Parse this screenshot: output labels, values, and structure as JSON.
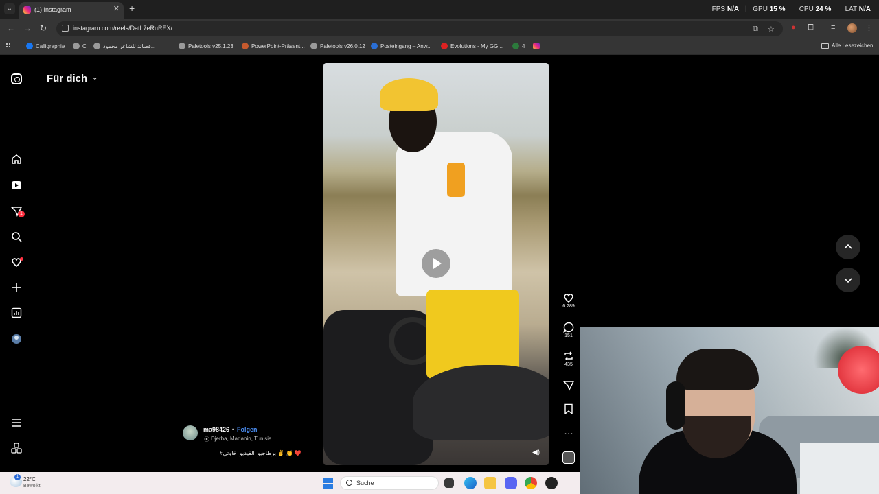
{
  "browser": {
    "tab_title": "(1) Instagram",
    "url": "instagram.com/reels/DatL7eRuREX/",
    "overlay": {
      "fps_label": "FPS",
      "fps_value": "N/A",
      "gpu_label": "GPU",
      "gpu_value": "15 %",
      "cpu_label": "CPU",
      "cpu_value": "24 %",
      "lat_label": "LAT",
      "lat_value": "N/A"
    },
    "bookmarks": [
      {
        "label": "Calligraphie",
        "color": "#1877f2"
      },
      {
        "label": "C",
        "color": "#9a9a9a"
      },
      {
        "label": "قصائد للشاعر محمود...",
        "color": "#9a9a9a"
      },
      {
        "label": "Paletools v25.1.23",
        "color": "#9a9a9a"
      },
      {
        "label": "PowerPoint-Präsent...",
        "color": "#c65a2e"
      },
      {
        "label": "Paletools v26.0.12",
        "color": "#9a9a9a"
      },
      {
        "label": "Posteingang – Anw...",
        "color": "#2a6fd6"
      },
      {
        "label": "Evolutions - My GG...",
        "color": "#d22"
      },
      {
        "label": "4",
        "color": "#2c7a3c"
      }
    ],
    "all_bookmarks_label": "Alle Lesezeichen"
  },
  "instagram": {
    "feed_title": "Für dich",
    "notification_count": "1",
    "reel": {
      "username": "ma98426",
      "separator": "•",
      "follow_label": "Folgen",
      "location": "Djerba, Madanin, Tunisia",
      "caption": "#برطاجيو_الفيديو_خاوتي ✌️ 👏 ❤️",
      "likes": "6.289",
      "comments": "151",
      "reposts": "435"
    }
  },
  "taskbar": {
    "temperature": "22°C",
    "condition": "Bewölkt",
    "weather_badge": "1",
    "search_placeholder": "Suche"
  },
  "colors": {
    "accent_follow": "#4a8cf0",
    "notification_red": "#ff3040"
  }
}
